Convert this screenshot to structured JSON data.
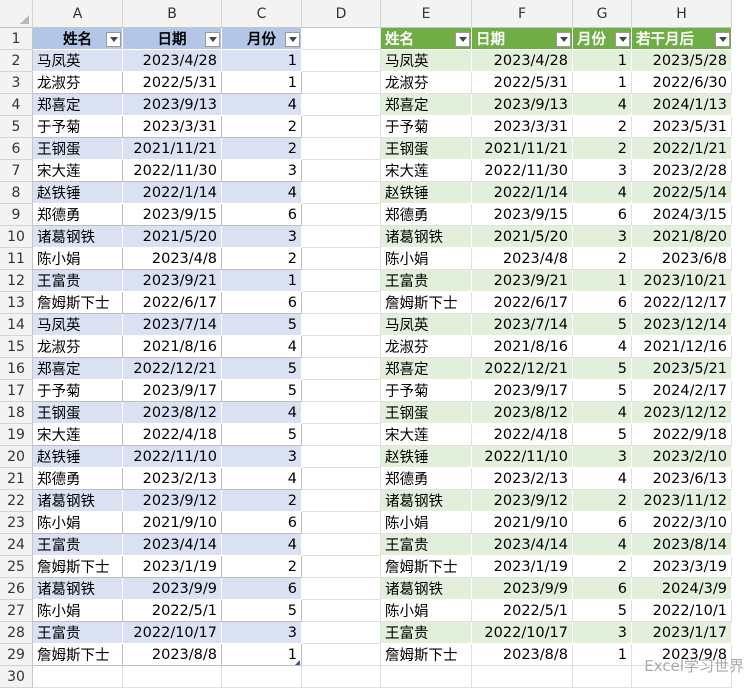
{
  "columns": [
    "A",
    "B",
    "C",
    "D",
    "E",
    "F",
    "G",
    "H"
  ],
  "rows": [
    1,
    2,
    3,
    4,
    5,
    6,
    7,
    8,
    9,
    10,
    11,
    12,
    13,
    14,
    15,
    16,
    17,
    18,
    19,
    20,
    21,
    22,
    23,
    24,
    25,
    26,
    27,
    28,
    29,
    30
  ],
  "table1": {
    "headers": [
      "姓名",
      "日期",
      "月份"
    ],
    "rows": [
      [
        "马凤英",
        "2023/4/28",
        "1"
      ],
      [
        "龙淑芬",
        "2022/5/31",
        "1"
      ],
      [
        "郑喜定",
        "2023/9/13",
        "4"
      ],
      [
        "于予菊",
        "2023/3/31",
        "2"
      ],
      [
        "王钢蛋",
        "2021/11/21",
        "2"
      ],
      [
        "宋大莲",
        "2022/11/30",
        "3"
      ],
      [
        "赵铁锤",
        "2022/1/14",
        "4"
      ],
      [
        "郑德勇",
        "2023/9/15",
        "6"
      ],
      [
        "诸葛钢铁",
        "2021/5/20",
        "3"
      ],
      [
        "陈小娟",
        "2023/4/8",
        "2"
      ],
      [
        "王富贵",
        "2023/9/21",
        "1"
      ],
      [
        "詹姆斯下士",
        "2022/6/17",
        "6"
      ],
      [
        "马凤英",
        "2023/7/14",
        "5"
      ],
      [
        "龙淑芬",
        "2021/8/16",
        "4"
      ],
      [
        "郑喜定",
        "2022/12/21",
        "5"
      ],
      [
        "于予菊",
        "2023/9/17",
        "5"
      ],
      [
        "王钢蛋",
        "2023/8/12",
        "4"
      ],
      [
        "宋大莲",
        "2022/4/18",
        "5"
      ],
      [
        "赵铁锤",
        "2022/11/10",
        "3"
      ],
      [
        "郑德勇",
        "2023/2/13",
        "4"
      ],
      [
        "诸葛钢铁",
        "2023/9/12",
        "2"
      ],
      [
        "陈小娟",
        "2021/9/10",
        "6"
      ],
      [
        "王富贵",
        "2023/4/14",
        "4"
      ],
      [
        "詹姆斯下士",
        "2023/1/19",
        "2"
      ],
      [
        "诸葛钢铁",
        "2023/9/9",
        "6"
      ],
      [
        "陈小娟",
        "2022/5/1",
        "5"
      ],
      [
        "王富贵",
        "2022/10/17",
        "3"
      ],
      [
        "詹姆斯下士",
        "2023/8/8",
        "1"
      ]
    ]
  },
  "table2": {
    "headers": [
      "姓名",
      "日期",
      "月份",
      "若干月后"
    ],
    "rows": [
      [
        "马凤英",
        "2023/4/28",
        "1",
        "2023/5/28"
      ],
      [
        "龙淑芬",
        "2022/5/31",
        "1",
        "2022/6/30"
      ],
      [
        "郑喜定",
        "2023/9/13",
        "4",
        "2024/1/13"
      ],
      [
        "于予菊",
        "2023/3/31",
        "2",
        "2023/5/31"
      ],
      [
        "王钢蛋",
        "2021/11/21",
        "2",
        "2022/1/21"
      ],
      [
        "宋大莲",
        "2022/11/30",
        "3",
        "2023/2/28"
      ],
      [
        "赵铁锤",
        "2022/1/14",
        "4",
        "2022/5/14"
      ],
      [
        "郑德勇",
        "2023/9/15",
        "6",
        "2024/3/15"
      ],
      [
        "诸葛钢铁",
        "2021/5/20",
        "3",
        "2021/8/20"
      ],
      [
        "陈小娟",
        "2023/4/8",
        "2",
        "2023/6/8"
      ],
      [
        "王富贵",
        "2023/9/21",
        "1",
        "2023/10/21"
      ],
      [
        "詹姆斯下士",
        "2022/6/17",
        "6",
        "2022/12/17"
      ],
      [
        "马凤英",
        "2023/7/14",
        "5",
        "2023/12/14"
      ],
      [
        "龙淑芬",
        "2021/8/16",
        "4",
        "2021/12/16"
      ],
      [
        "郑喜定",
        "2022/12/21",
        "5",
        "2023/5/21"
      ],
      [
        "于予菊",
        "2023/9/17",
        "5",
        "2024/2/17"
      ],
      [
        "王钢蛋",
        "2023/8/12",
        "4",
        "2023/12/12"
      ],
      [
        "宋大莲",
        "2022/4/18",
        "5",
        "2022/9/18"
      ],
      [
        "赵铁锤",
        "2022/11/10",
        "3",
        "2023/2/10"
      ],
      [
        "郑德勇",
        "2023/2/13",
        "4",
        "2023/6/13"
      ],
      [
        "诸葛钢铁",
        "2023/9/12",
        "2",
        "2023/11/12"
      ],
      [
        "陈小娟",
        "2021/9/10",
        "6",
        "2022/3/10"
      ],
      [
        "王富贵",
        "2023/4/14",
        "4",
        "2023/8/14"
      ],
      [
        "詹姆斯下士",
        "2023/1/19",
        "2",
        "2023/3/19"
      ],
      [
        "诸葛钢铁",
        "2023/9/9",
        "6",
        "2024/3/9"
      ],
      [
        "陈小娟",
        "2022/5/1",
        "5",
        "2022/10/1"
      ],
      [
        "王富贵",
        "2022/10/17",
        "3",
        "2023/1/17"
      ],
      [
        "詹姆斯下士",
        "2023/8/8",
        "1",
        "2023/9/8"
      ]
    ]
  },
  "watermark": "Excel学习世界",
  "colors": {
    "table1_header": "#b4c6e7",
    "table1_band": "#d9e1f2",
    "table2_header": "#70ad47",
    "table2_band": "#e2efda"
  }
}
